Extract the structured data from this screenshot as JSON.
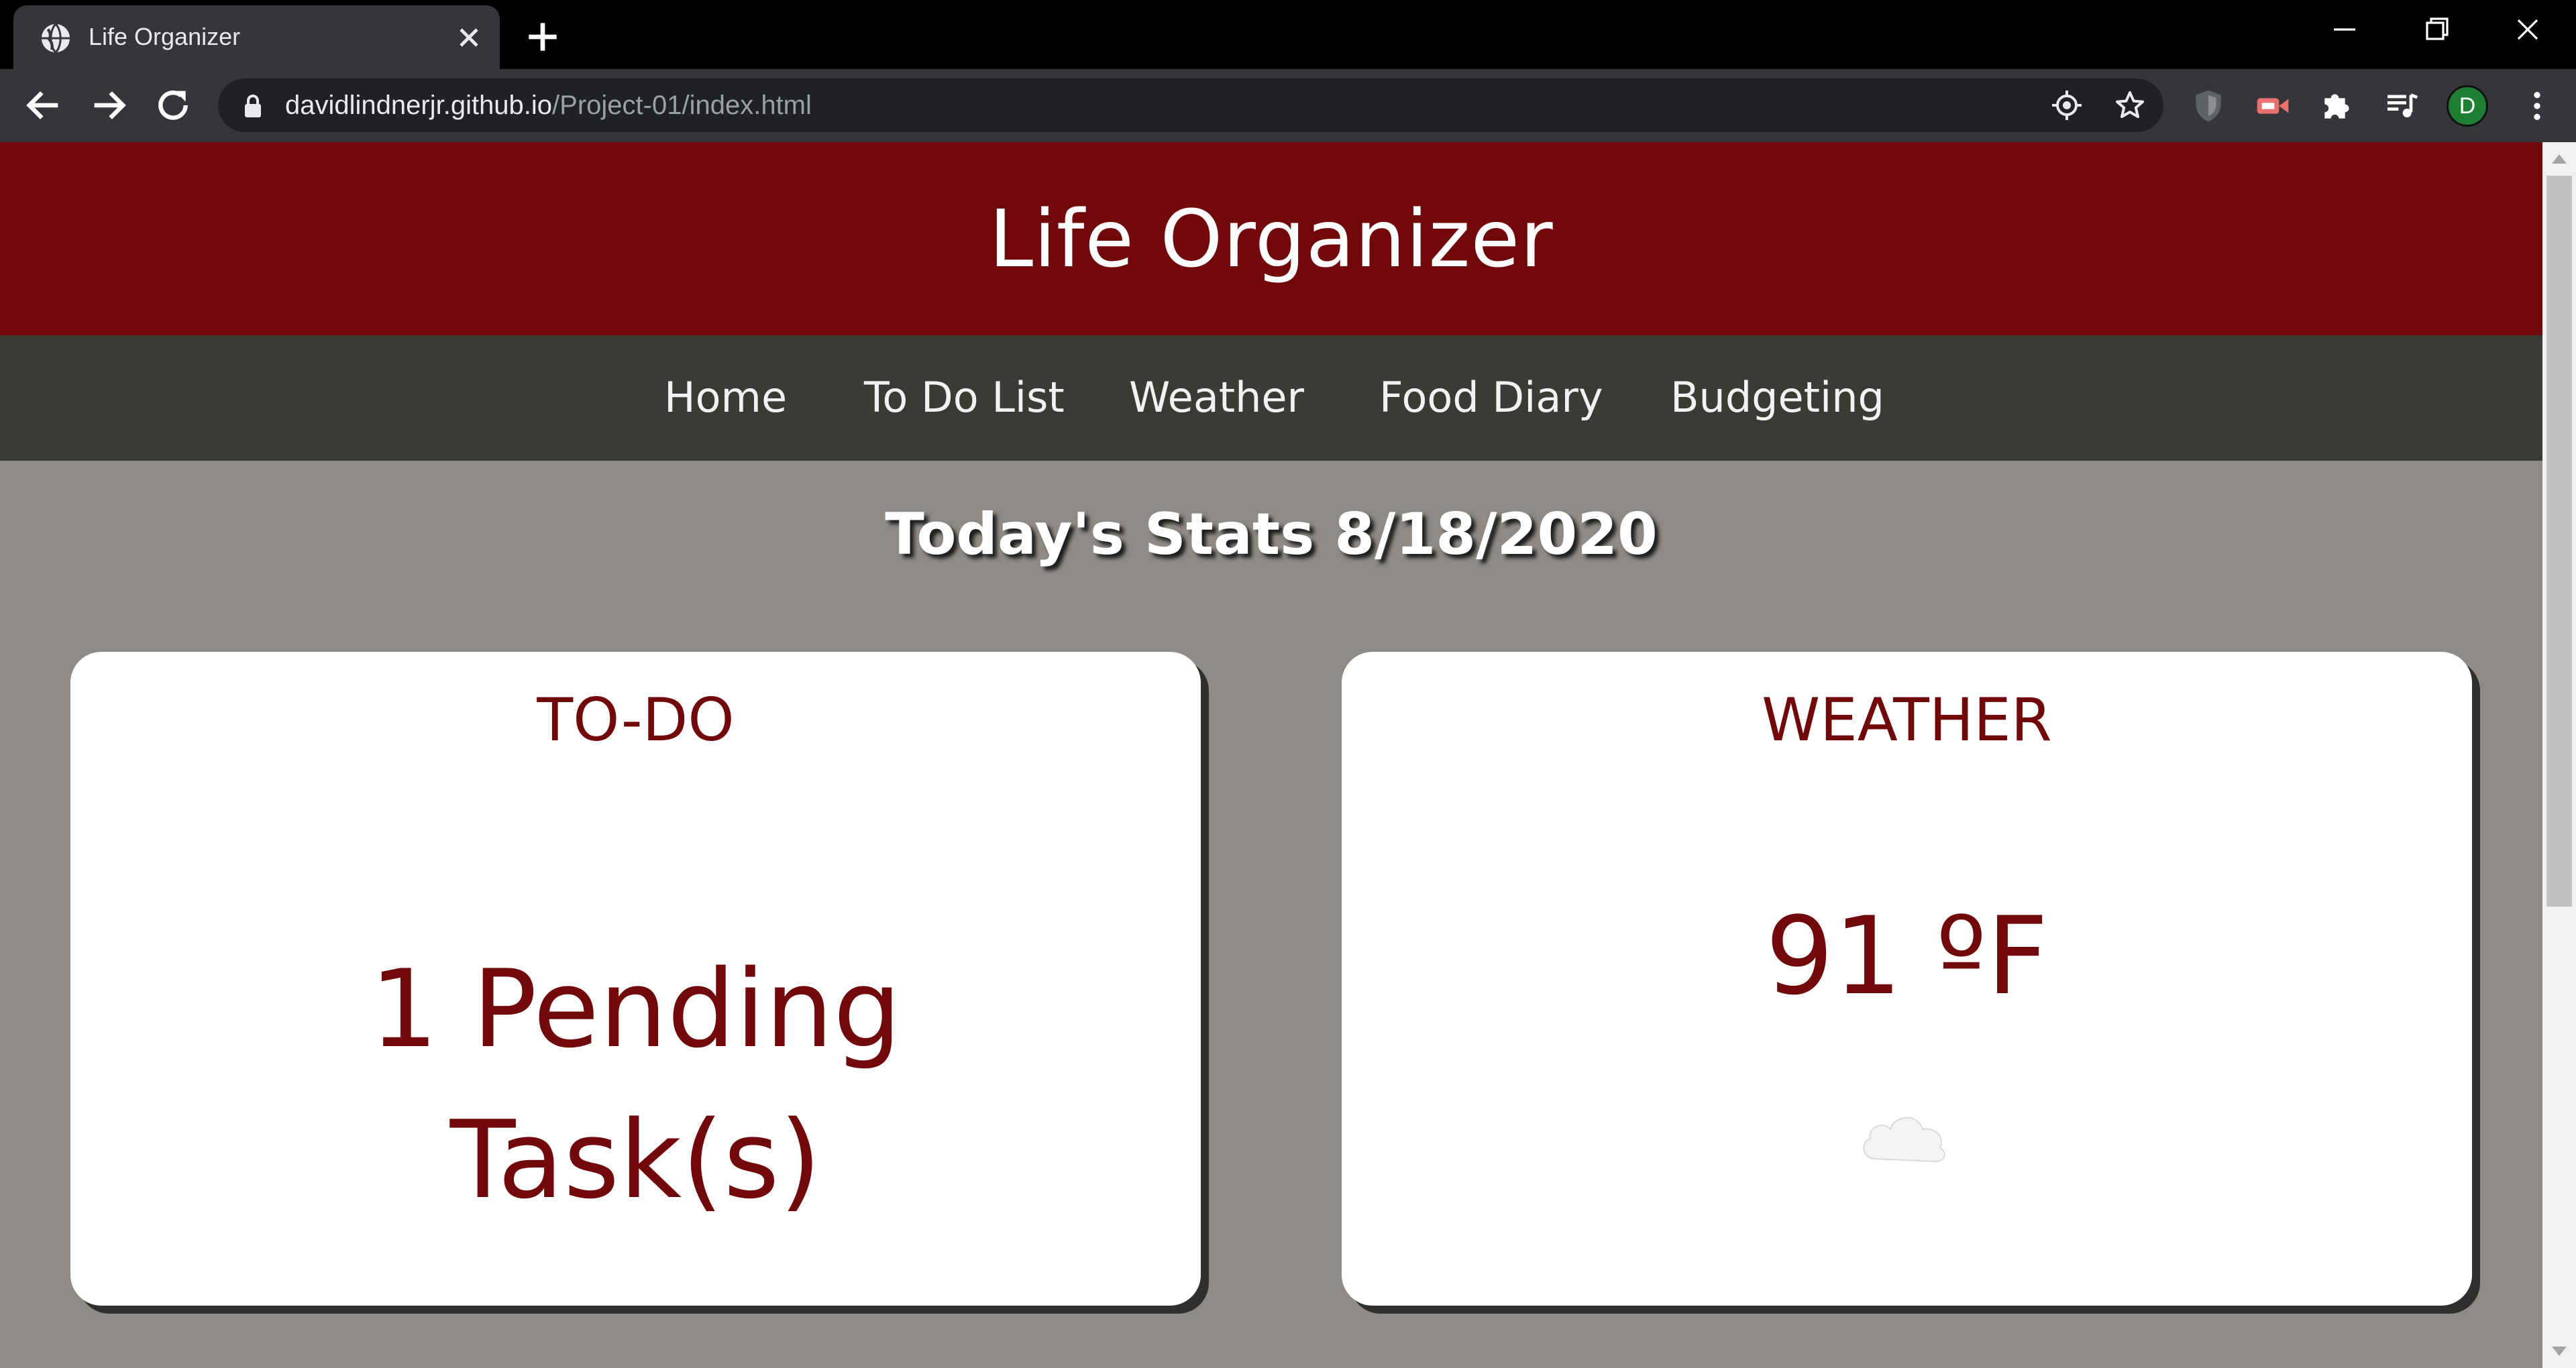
{
  "browser": {
    "tab_title": "Life Organizer",
    "url_host": "davidlindnerjr.github.io",
    "url_path": "/Project-01/index.html",
    "profile_initial": "D",
    "icons": [
      "globe-icon",
      "close-icon",
      "plus-icon",
      "minimize-icon",
      "restore-icon",
      "window-close-icon",
      "back-arrow-icon",
      "forward-arrow-icon",
      "reload-icon",
      "lock-icon",
      "location-target-icon",
      "star-icon",
      "shield-extension-icon",
      "video-extension-icon",
      "puzzle-extension-icon",
      "media-control-icon",
      "more-vert-icon"
    ]
  },
  "site": {
    "title": "Life Organizer",
    "nav": [
      "Home",
      "To Do List",
      "Weather",
      "Food Diary",
      "Budgeting"
    ],
    "stats_heading": "Today's Stats 8/18/2020"
  },
  "cards": {
    "todo": {
      "title": "TO-DO",
      "line1": "1 Pending",
      "line2": "Task(s)"
    },
    "weather": {
      "title": "WEATHER",
      "temperature": "91 ºF",
      "icon": "cloud-icon"
    }
  },
  "colors": {
    "header_bg": "#71090b",
    "nav_bg": "#3a3a37",
    "page_bg": "#8e8b86",
    "accent_text": "#71090b"
  }
}
